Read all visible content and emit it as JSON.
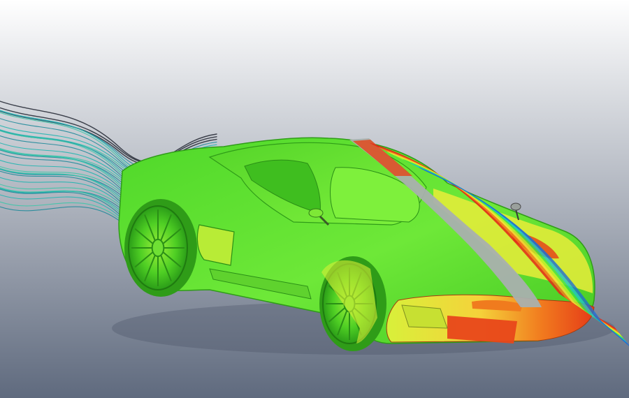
{
  "viewport": {
    "background_top": "#ffffff",
    "background_bottom": "#5f6a7e"
  },
  "scene": {
    "subject": "sports car",
    "visualization": "streamlines",
    "colormap": [
      "#1f6fd6",
      "#20c6c8",
      "#3ee04a",
      "#b8f02a",
      "#f4e23a",
      "#f27a1e",
      "#e32b18"
    ],
    "body_color": "#5de62f",
    "streamline_color": "#1aa0a0",
    "stripe_color": "#a9b0ae"
  }
}
